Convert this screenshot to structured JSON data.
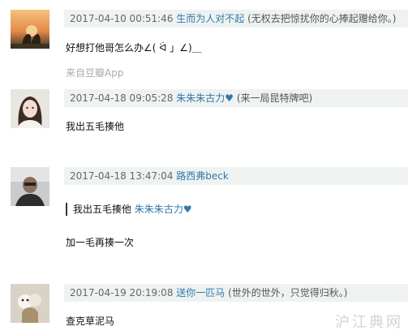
{
  "comments": [
    {
      "time": "2017-04-10 00:51:46",
      "user": "生而为人对不起",
      "signature": "(无权去把惊扰你的心捧起赠给你。)",
      "text": "好想打他哥怎么办∠( ᐛ 」∠)＿",
      "source": "来自豆瓣App"
    },
    {
      "time": "2017-04-18 09:05:28",
      "user": "朱朱朱古力♥",
      "signature": "(来一局昆特牌吧)",
      "text": "我出五毛揍他"
    },
    {
      "time": "2017-04-18 13:47:04",
      "user": "路西弗beck",
      "signature": "",
      "quote_text": "我出五毛揍他",
      "quote_user": "朱朱朱古力♥",
      "text": "加一毛再揍一次"
    },
    {
      "time": "2017-04-19 20:19:08",
      "user": "送你一匹马",
      "signature": "(世外的世外，只觉得归秋。)",
      "text": "查克草泥马"
    }
  ],
  "watermark": "沪江典网",
  "colors": {
    "meta_bg": "#eef3f2",
    "user_link": "#3377aa",
    "source_gray": "#aaaaaa"
  }
}
